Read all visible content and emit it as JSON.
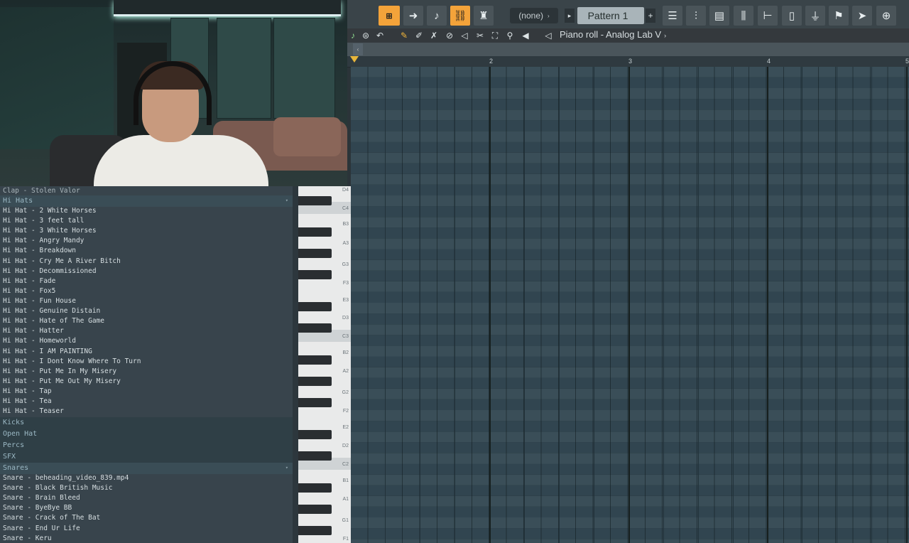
{
  "toolbar": {
    "snap_value": "(none)",
    "pattern": "Pattern 1",
    "add_label": "+"
  },
  "piano_roll": {
    "title": "Piano roll - Analog Lab V",
    "bars": [
      "2",
      "3",
      "4",
      "5"
    ]
  },
  "keyboard": {
    "labels": [
      "D4",
      "C4",
      "B3",
      "A3",
      "G3",
      "F3",
      "E3",
      "D3",
      "C3",
      "B2",
      "A2",
      "G2",
      "F2",
      "E2",
      "D2",
      "C2",
      "B1",
      "A1",
      "G1",
      "F1"
    ]
  },
  "browser": {
    "top_item": "Clap - Stolen Valor",
    "folders": {
      "hihats": "Hi Hats",
      "kicks": "Kicks",
      "openhat": "Open Hat",
      "percs": "Percs",
      "sfx": "SFX",
      "snares": "Snares"
    },
    "hihat_items": [
      "Hi Hat - 2 White Horses",
      "Hi Hat - 3 feet tall",
      "Hi Hat - 3 White Horses",
      "Hi Hat - Angry Mandy",
      "Hi Hat - Breakdown",
      "Hi Hat - Cry Me A River Bitch",
      "Hi Hat - Decommissioned",
      "Hi Hat - Fade",
      "Hi Hat - Fox5",
      "Hi Hat - Fun House",
      "Hi Hat - Genuine Distain",
      "Hi Hat - Hate of The Game",
      "Hi Hat - Hatter",
      "Hi Hat - Homeworld",
      "Hi Hat - I AM PAINTING",
      "Hi Hat - I Dont Know Where To Turn",
      "Hi Hat - Put Me In My Misery",
      "Hi Hat - Put Me Out My Misery",
      "Hi Hat - Tap",
      "Hi Hat - Tea",
      "Hi Hat - Teaser"
    ],
    "snare_items": [
      "Snare - beheading_video_839.mp4",
      "Snare - Black British Music",
      "Snare - Brain Bleed",
      "Snare - ByeBye BB",
      "Snare - Crack of The Bat",
      "Snare - End Ur Life",
      "Snare - Keru"
    ]
  }
}
